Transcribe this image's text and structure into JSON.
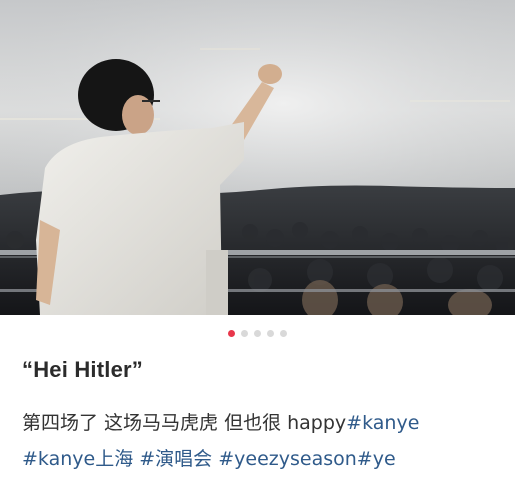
{
  "post": {
    "title": "“Hei Hitler”",
    "body_text": "第四场了 这场马马虎虎 但也很 happy",
    "tags": [
      "#kanye",
      "#kanye上海",
      "#演唱会",
      "#yeezyseason",
      "#ye"
    ]
  },
  "carousel": {
    "total": 5,
    "current": 1
  },
  "colors": {
    "dot_active": "#e8374b",
    "dot_inactive": "#d9d9d9",
    "tag": "#2f5a8a",
    "title": "#2b2b2b"
  }
}
